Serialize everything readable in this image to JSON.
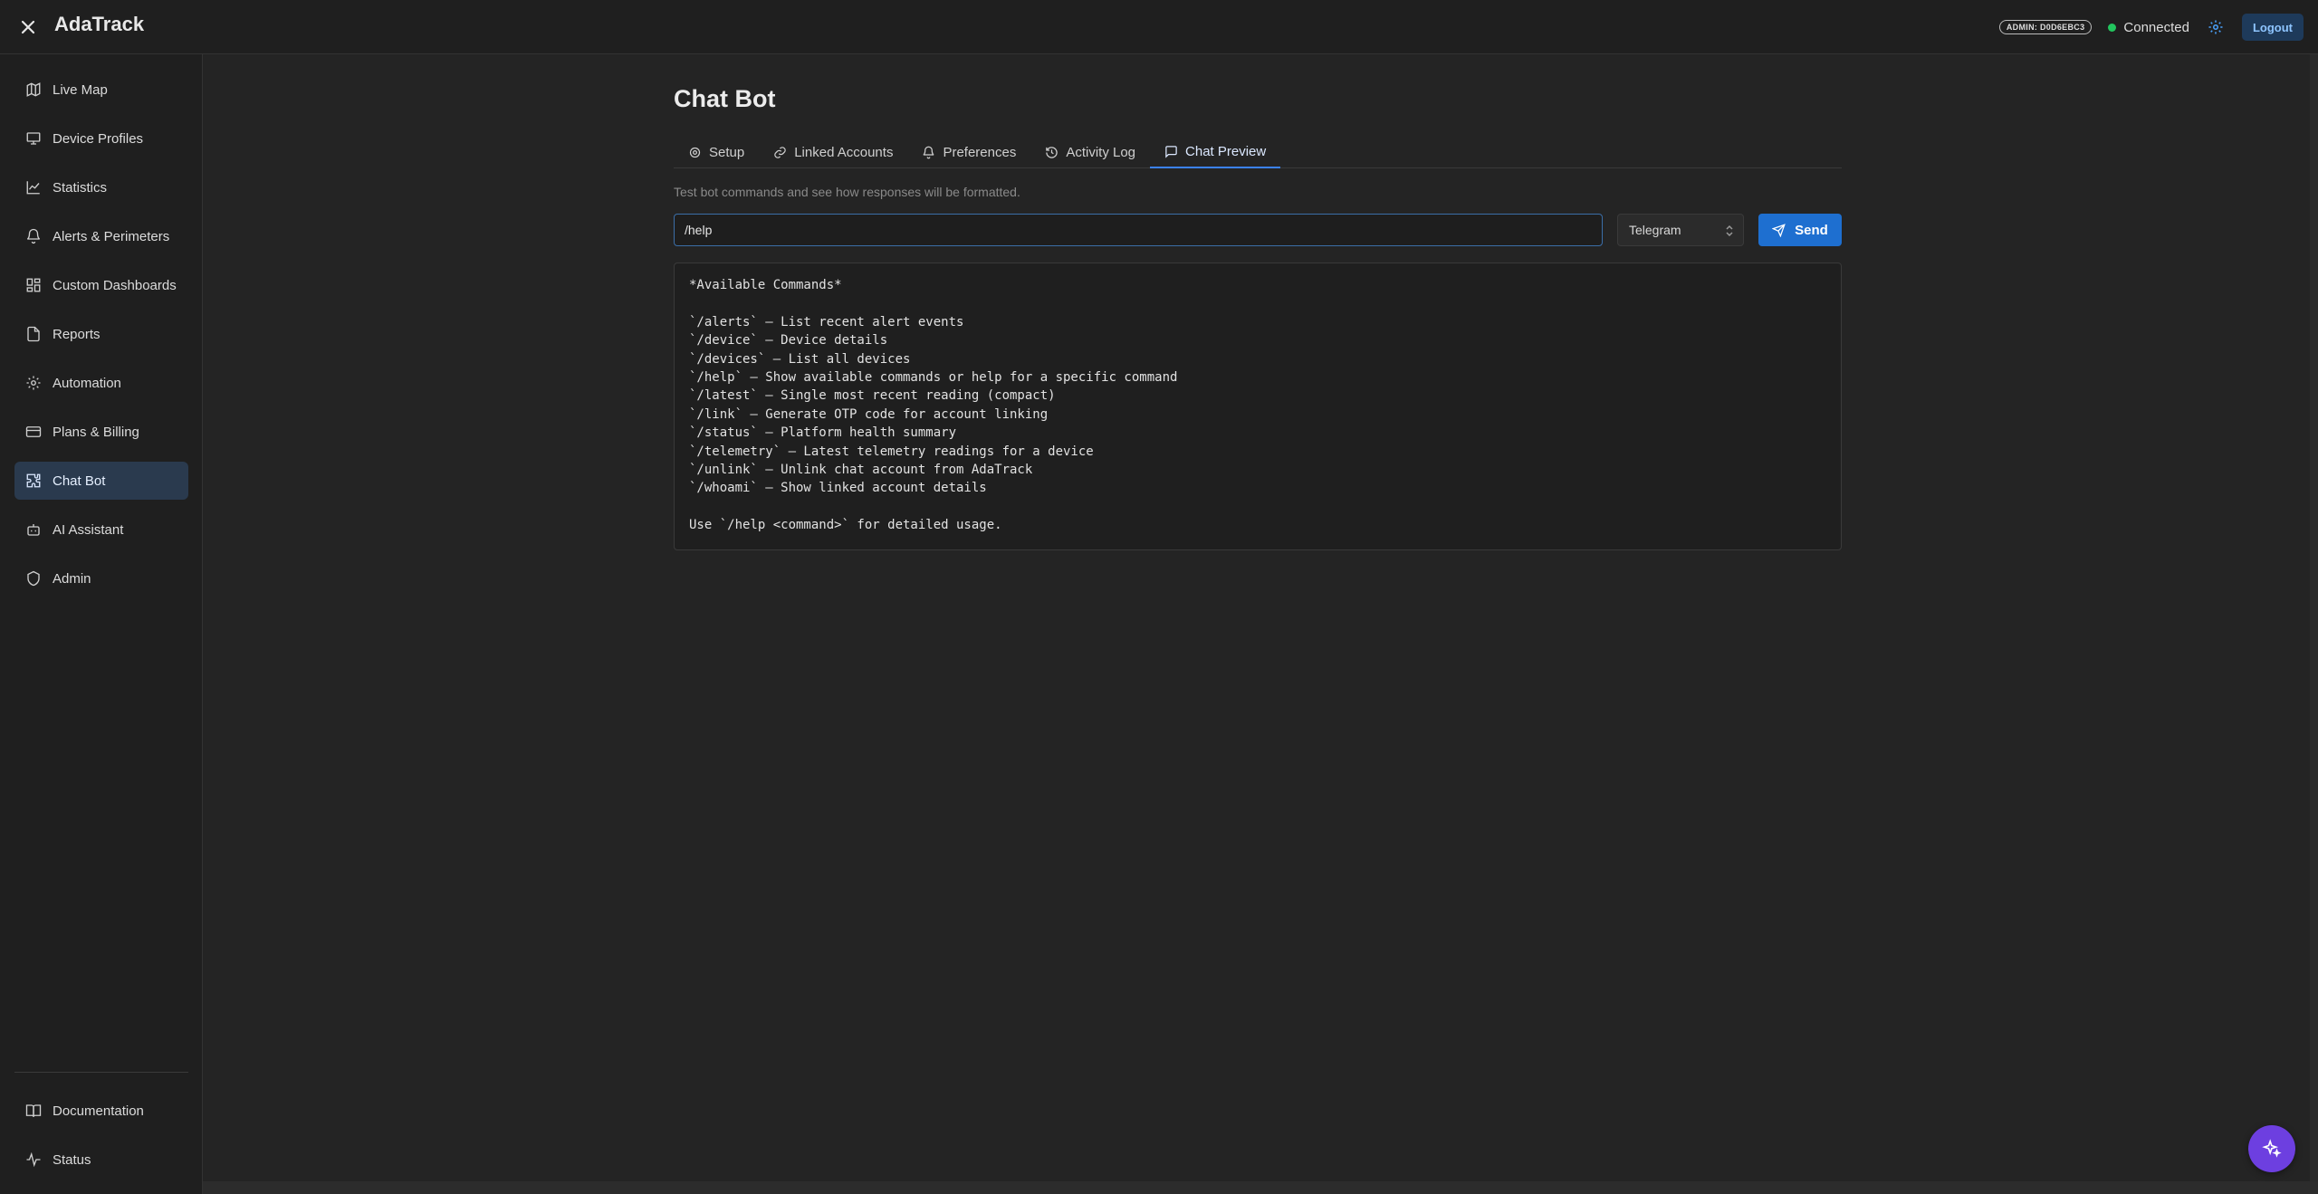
{
  "header": {
    "app_title": "AdaTrack",
    "admin_badge": "ADMIN: D0D6EBC3",
    "connection_status": "Connected",
    "logout_label": "Logout"
  },
  "sidebar": {
    "items": [
      {
        "label": "Live Map",
        "icon": "map-icon"
      },
      {
        "label": "Device Profiles",
        "icon": "monitor-icon"
      },
      {
        "label": "Statistics",
        "icon": "chart-line-icon"
      },
      {
        "label": "Alerts & Perimeters",
        "icon": "bell-icon"
      },
      {
        "label": "Custom Dashboards",
        "icon": "dashboard-icon"
      },
      {
        "label": "Reports",
        "icon": "file-icon"
      },
      {
        "label": "Automation",
        "icon": "cog-automation-icon"
      },
      {
        "label": "Plans & Billing",
        "icon": "credit-card-icon"
      },
      {
        "label": "Chat Bot",
        "icon": "puzzle-icon",
        "active": true
      },
      {
        "label": "AI Assistant",
        "icon": "bot-icon"
      },
      {
        "label": "Admin",
        "icon": "shield-icon"
      }
    ],
    "footer_items": [
      {
        "label": "Documentation",
        "icon": "book-icon"
      },
      {
        "label": "Status",
        "icon": "activity-icon"
      }
    ]
  },
  "main": {
    "page_title": "Chat Bot",
    "tabs": [
      {
        "label": "Setup",
        "icon": "gear-icon"
      },
      {
        "label": "Linked Accounts",
        "icon": "link-icon"
      },
      {
        "label": "Preferences",
        "icon": "bell-icon"
      },
      {
        "label": "Activity Log",
        "icon": "history-icon"
      },
      {
        "label": "Chat Preview",
        "icon": "message-icon",
        "active": true
      }
    ],
    "subtitle": "Test bot commands and see how responses will be formatted.",
    "command_input_value": "/help",
    "platform_selected": "Telegram",
    "send_label": "Send",
    "response_lines": [
      "*Available Commands*",
      "",
      "`/alerts` — List recent alert events",
      "`/device` — Device details",
      "`/devices` — List all devices",
      "`/help` — Show available commands or help for a specific command",
      "`/latest` — Single most recent reading (compact)",
      "`/link` — Generate OTP code for account linking",
      "`/status` — Platform health summary",
      "`/telemetry` — Latest telemetry readings for a device",
      "`/unlink` — Unlink chat account from AdaTrack",
      "`/whoami` — Show linked account details",
      "",
      "Use `/help <command>` for detailed usage."
    ]
  },
  "colors": {
    "accent": "#1e6fd0",
    "active_nav_bg": "#2a3a4e",
    "connected_dot": "#22c55e",
    "fab": "#6d3fe0"
  }
}
